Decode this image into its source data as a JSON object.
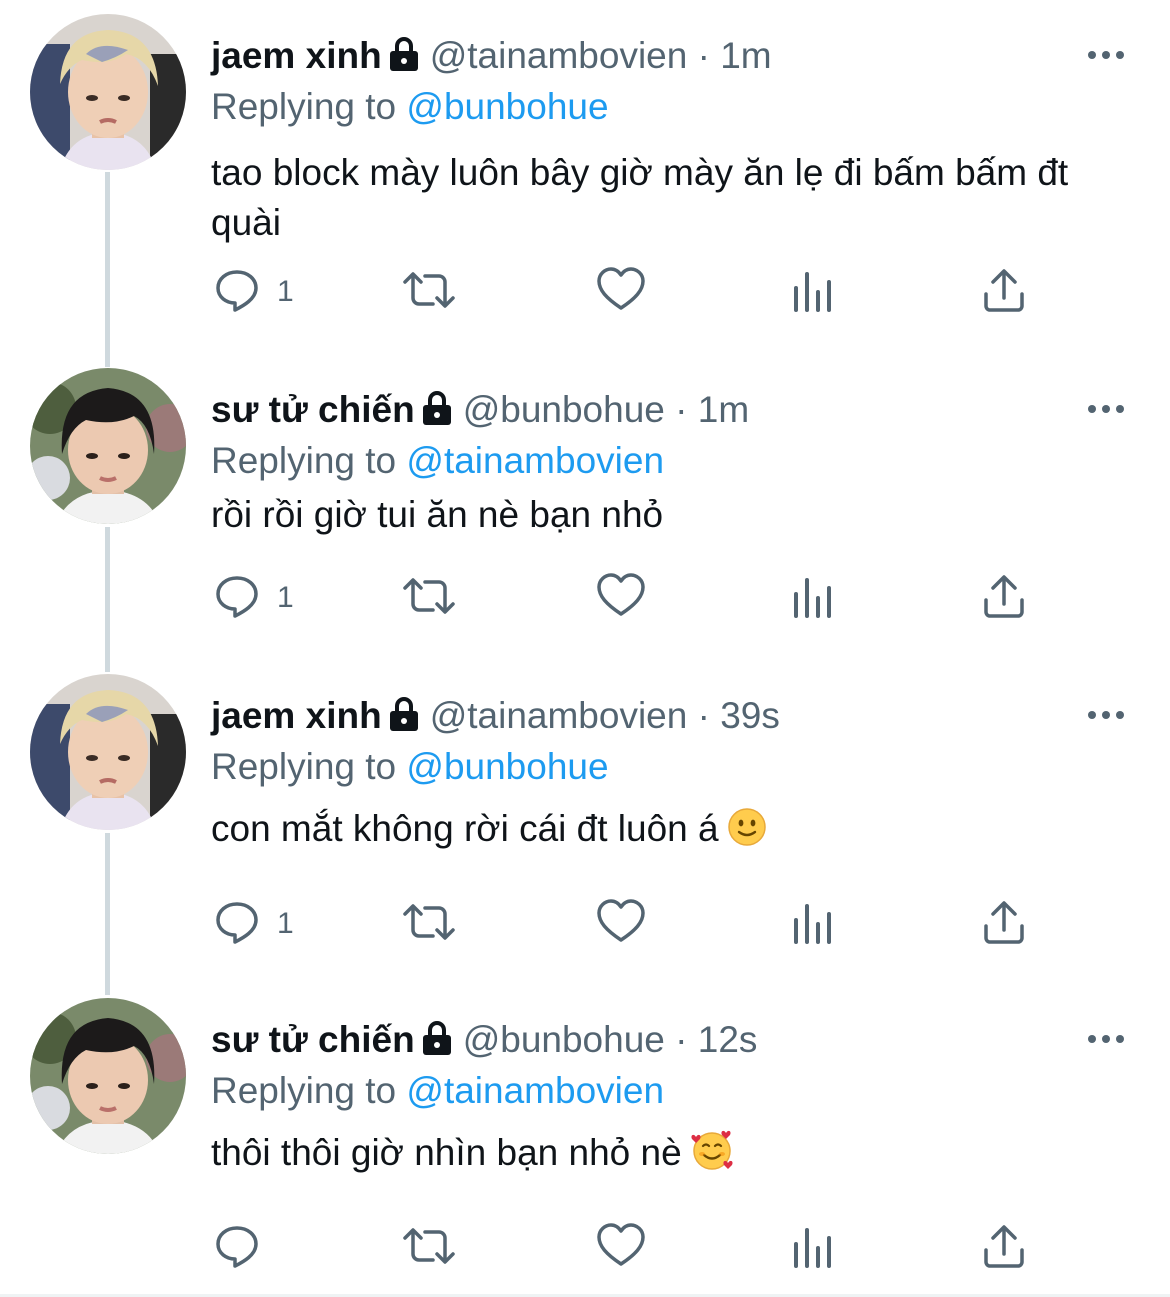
{
  "replying_prefix": "Replying to",
  "colors": {
    "accent": "#1d9bf0",
    "secondary_text": "#536471",
    "thread_line": "#cfd9de"
  },
  "tweets": [
    {
      "name": "jaem xinh",
      "handle": "@tainambovien",
      "time": "1m",
      "replying_to": "@bunbohue",
      "text": "tao block mày luôn bây giờ mày ăn lẹ đi bấm bấm đt quài",
      "reply_count": "1",
      "avatar": "blond-hair-avatar",
      "emoji": ""
    },
    {
      "name": "sư tử chiến",
      "handle": "@bunbohue",
      "time": "1m",
      "replying_to": "@tainambovien",
      "text": "rồi rồi giờ tui ăn nè bạn nhỏ",
      "reply_count": "1",
      "avatar": "dark-hair-avatar",
      "emoji": ""
    },
    {
      "name": "jaem xinh",
      "handle": "@tainambovien",
      "time": "39s",
      "replying_to": "@bunbohue",
      "text": "con mắt không rời cái đt luôn á",
      "reply_count": "1",
      "avatar": "blond-hair-avatar",
      "emoji": "slightly-smiling-face"
    },
    {
      "name": "sư tử chiến",
      "handle": "@bunbohue",
      "time": "12s",
      "replying_to": "@tainambovien",
      "text": "thôi thôi giờ nhìn bạn nhỏ nè",
      "reply_count": "",
      "avatar": "dark-hair-avatar",
      "emoji": "smiling-face-with-hearts"
    }
  ]
}
